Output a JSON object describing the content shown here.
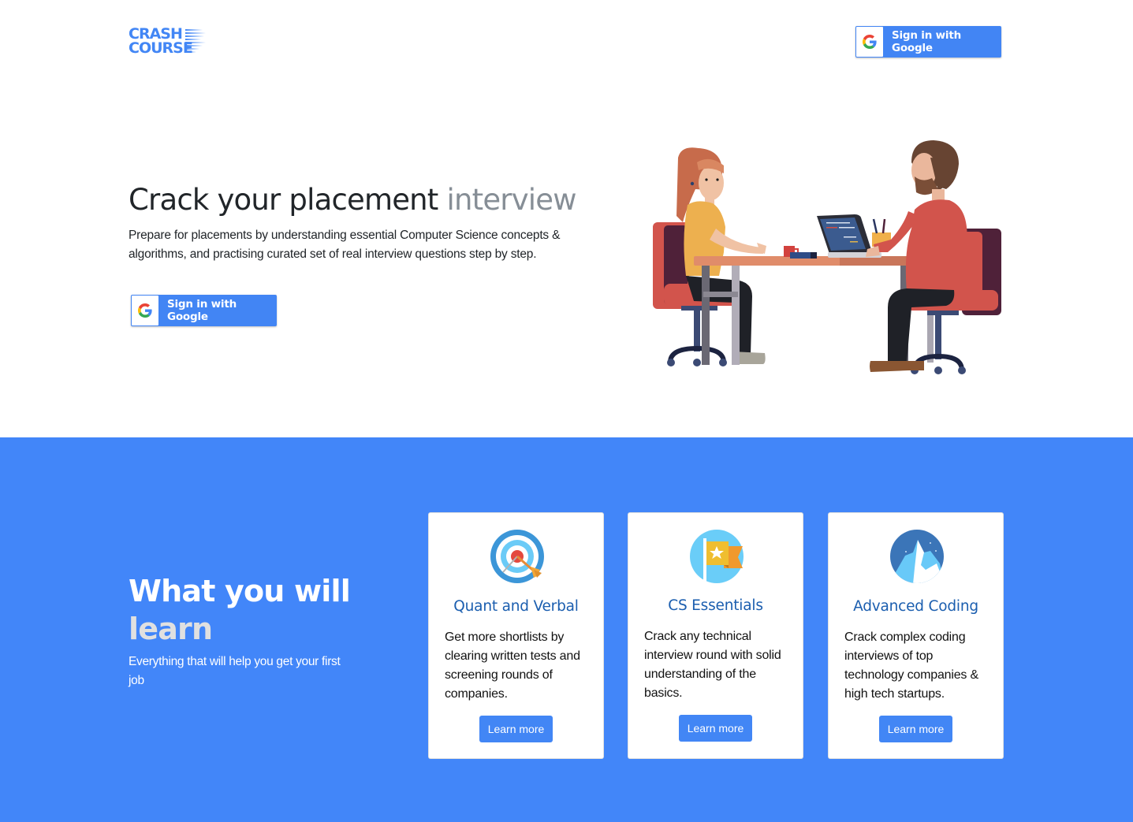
{
  "brand": {
    "logo_line1": "CRASH",
    "logo_line2": "COURSE",
    "accent_color": "#4286f5"
  },
  "header": {
    "signin_label": "Sign in with Google",
    "signin_icon": "google-g-icon"
  },
  "hero": {
    "title_main": "Crack your placement",
    "title_muted": "interview",
    "description": "Prepare for placements by understanding essential Computer Science concepts & algorithms, and practising curated set of real interview questions step by step.",
    "signin_label": "Sign in with Google",
    "illustration": "interview-illustration"
  },
  "learn": {
    "title_main": "What you will",
    "title_muted": "learn",
    "subtitle": "Everything that will help you get your first job",
    "background_color": "#4286f9",
    "cards": [
      {
        "icon": "target-icon",
        "title": "Quant and Verbal",
        "text": "Get more shortlists by clearing written tests and screening rounds of companies.",
        "button_label": "Learn more"
      },
      {
        "icon": "flag-icon",
        "title": "CS Essentials",
        "text": "Crack any technical interview round with solid understanding of the basics.",
        "button_label": "Learn more"
      },
      {
        "icon": "mountain-icon",
        "title": "Advanced Coding",
        "text": "Crack complex coding interviews of top technology companies & high tech startups.",
        "button_label": "Learn more"
      }
    ]
  }
}
